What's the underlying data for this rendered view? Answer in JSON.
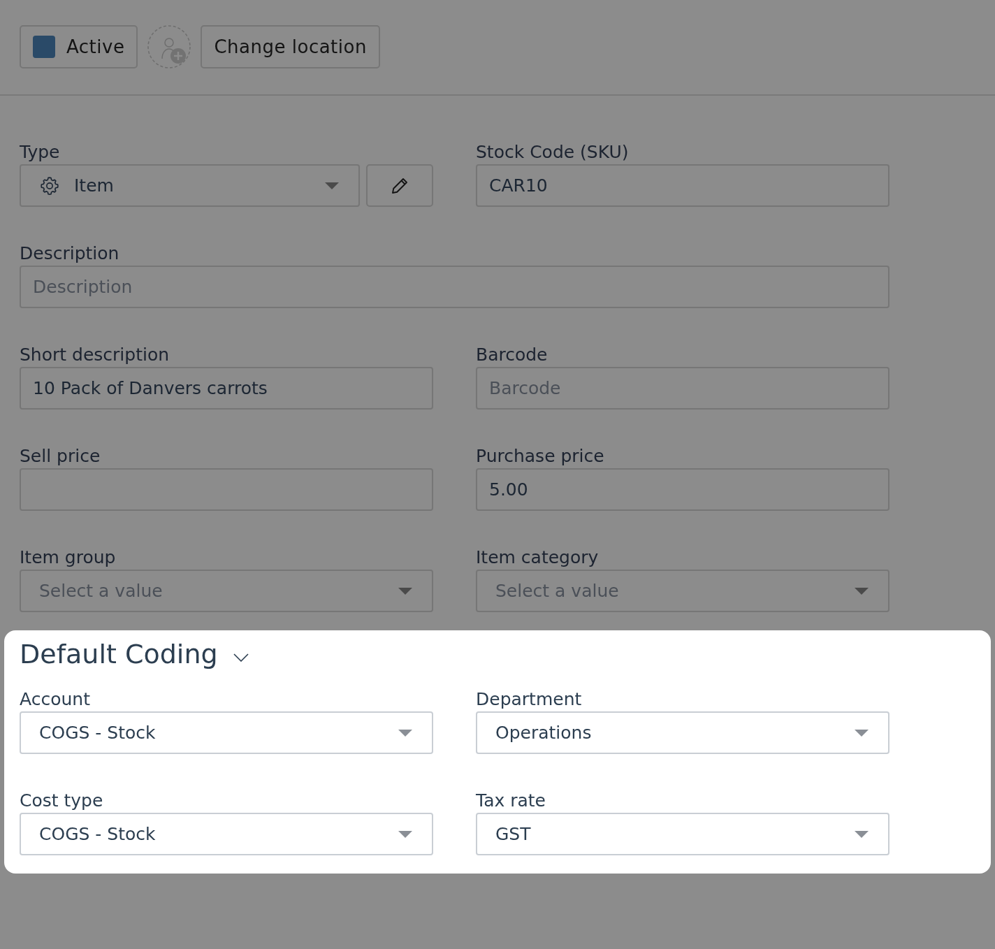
{
  "toolbar": {
    "status": {
      "label": "Active",
      "checked": true
    },
    "add_user": {
      "kind": "add_user"
    },
    "change_location": {
      "label": "Change location"
    }
  },
  "form": {
    "fields": [
      {
        "label": "Type",
        "kind": "select_with_edit",
        "value": "Item"
      },
      {
        "label": "Stock Code (SKU)",
        "kind": "input",
        "value": "CAR10"
      },
      {
        "label": "Description",
        "kind": "input",
        "placeholder": "Description",
        "wide": true
      },
      {
        "label": "Short description",
        "kind": "input",
        "value": "10 Pack of Danvers carrots"
      },
      {
        "label": "Barcode",
        "kind": "input",
        "placeholder": "Barcode"
      },
      {
        "label": "Sell price",
        "kind": "input"
      },
      {
        "label": "Purchase price",
        "kind": "input",
        "value": "5.00"
      },
      {
        "label": "Item group",
        "kind": "select",
        "placeholder": "Select a value"
      },
      {
        "label": "Item category",
        "kind": "select",
        "placeholder": "Select a value"
      }
    ]
  },
  "default_coding": {
    "title": "Default Coding",
    "expanded": true,
    "fields": [
      {
        "label": "Account",
        "kind": "select",
        "value": "COGS - Stock"
      },
      {
        "label": "Department",
        "kind": "select",
        "value": "Operations"
      },
      {
        "label": "Cost type",
        "kind": "select",
        "value": "COGS - Stock"
      },
      {
        "label": "Tax rate",
        "kind": "select",
        "value": "GST"
      }
    ]
  }
}
